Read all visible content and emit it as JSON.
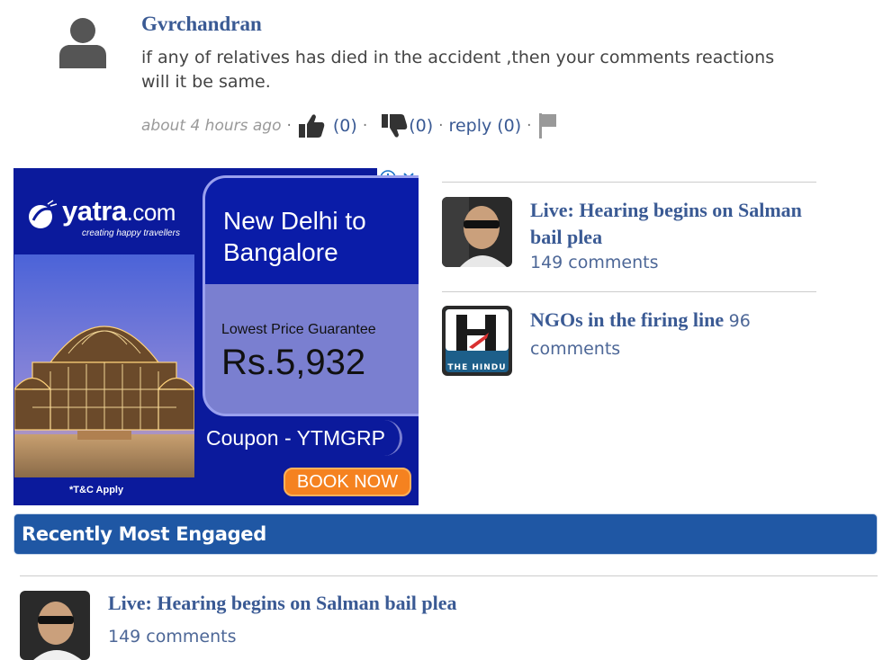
{
  "comment": {
    "author": "Gvrchandran",
    "text": "if any of relatives has died in the accident ,then your comments reactions will it be same.",
    "time": "about 4 hours ago",
    "likes": "(0)",
    "dislikes": "(0)",
    "reply": "reply (0)",
    "separator": "·"
  },
  "ad": {
    "brand": "yatra",
    "brand_suffix": ".com",
    "tagline": "creating happy travellers",
    "route": "New Delhi to Bangalore",
    "guarantee": "Lowest Price Guarantee",
    "price": "Rs.5,932",
    "coupon": "Coupon - YTMGRP",
    "cta": "BOOK NOW",
    "terms": "*T&C Apply",
    "colors": {
      "background": "#0b1a9c",
      "panel": "#7a7fd0",
      "cta": "#f58220"
    }
  },
  "related": [
    {
      "title": "Live: Hearing begins on Salman bail plea",
      "count": "149 comments",
      "thumb_icon": "person-photo"
    },
    {
      "title": "NGOs in the firing line",
      "count": "96 comments",
      "thumb_icon": "the-hindu-logo",
      "thumb_text": "THE HINDU"
    }
  ],
  "section": {
    "title": "Recently Most Engaged",
    "color": "#1f57a4"
  },
  "engaged": [
    {
      "title": "Live: Hearing begins on Salman bail plea",
      "count": "149 comments"
    }
  ]
}
